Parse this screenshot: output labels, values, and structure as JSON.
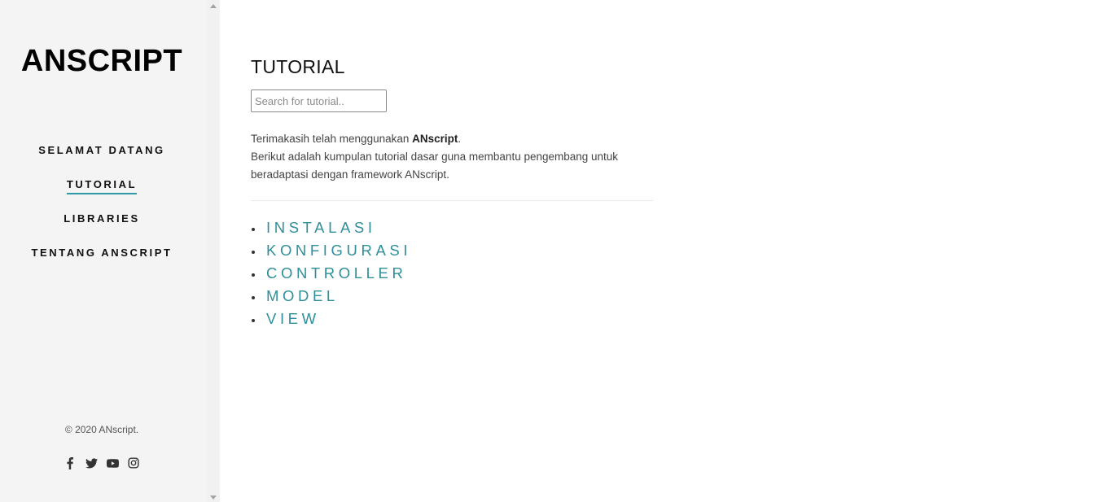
{
  "sidebar": {
    "brand": "ANSCRIPT",
    "nav": [
      {
        "label": "SELAMAT DATANG",
        "active": false
      },
      {
        "label": "TUTORIAL",
        "active": true
      },
      {
        "label": "LIBRARIES",
        "active": false
      },
      {
        "label": "TENTANG ANSCRIPT",
        "active": false
      }
    ],
    "copyright": "© 2020 ANscript.",
    "social_icons": [
      "facebook-icon",
      "twitter-icon",
      "youtube-icon",
      "instagram-icon"
    ]
  },
  "main": {
    "title": "TUTORIAL",
    "search": {
      "placeholder": "Search for tutorial..",
      "value": ""
    },
    "intro": {
      "line1_prefix": "Terimakasih telah menggunakan ",
      "line1_bold": "ANscript",
      "line1_suffix": ".",
      "line2": "Berikut adalah kumpulan tutorial dasar guna membantu pengembang untuk beradaptasi dengan framework ANscript."
    },
    "tutorials": [
      "INSTALASI",
      "KONFIGURASI",
      "CONTROLLER",
      "MODEL",
      "VIEW"
    ]
  },
  "colors": {
    "accent": "#2f8f9a",
    "sidebar_bg": "#f4f4f4",
    "active_underline": "#2f9aa6"
  }
}
